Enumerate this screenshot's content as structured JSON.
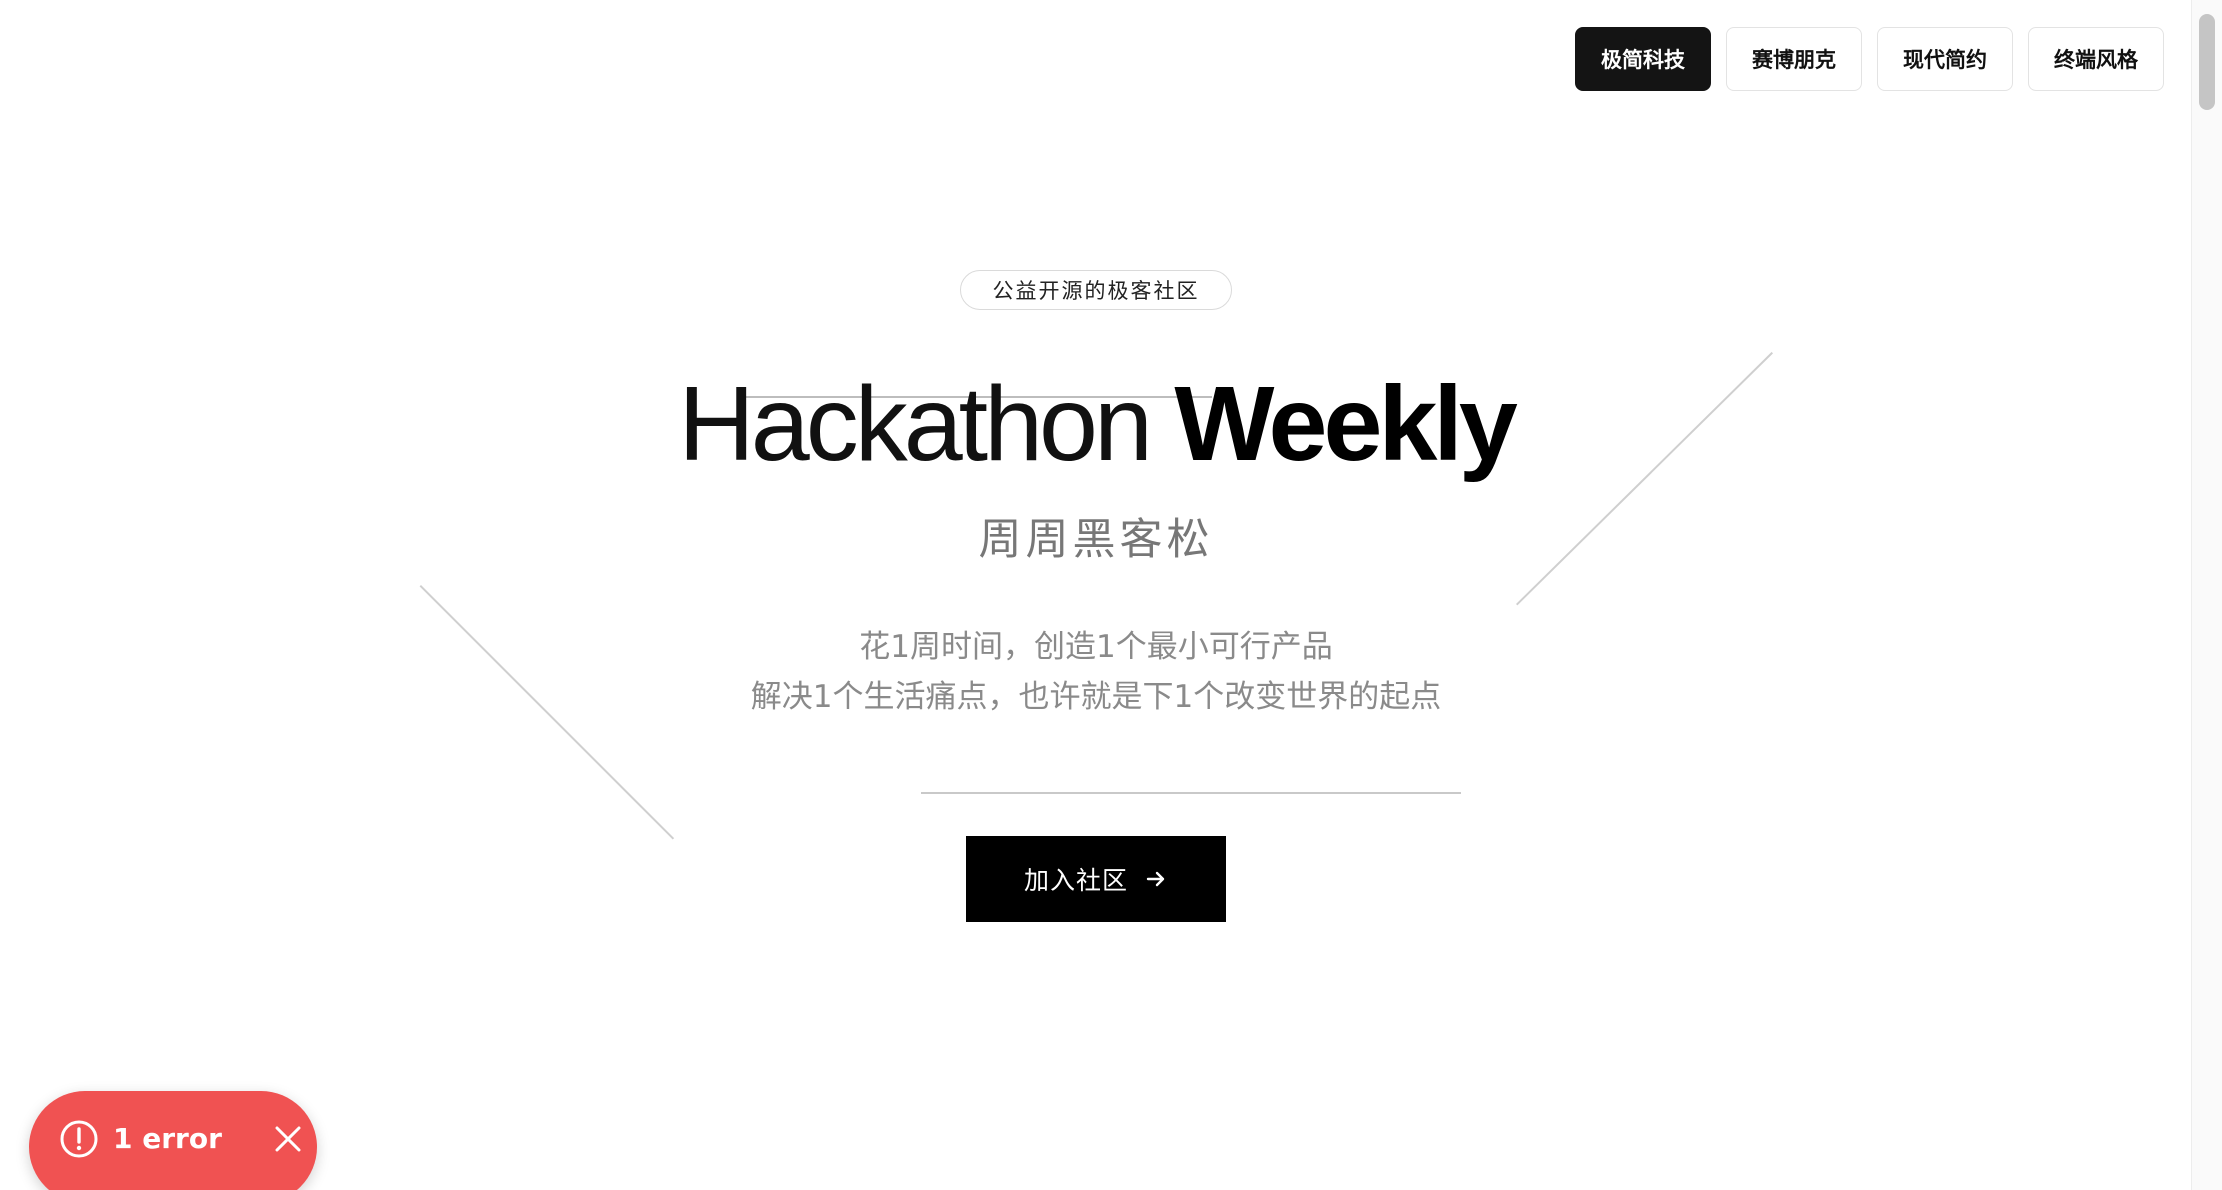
{
  "theme_switcher": {
    "options": [
      {
        "label": "极简科技",
        "active": true
      },
      {
        "label": "赛博朋克",
        "active": false
      },
      {
        "label": "现代简约",
        "active": false
      },
      {
        "label": "终端风格",
        "active": false
      }
    ]
  },
  "hero": {
    "badge": "公益开源的极客社区",
    "title_light": "Hackathon",
    "title_bold": "Weekly",
    "subtitle": "周周黑客松",
    "description_lines": [
      "花1周时间，创造1个最小可行产品",
      "解决1个生活痛点，也许就是下1个改变世界的起点"
    ],
    "cta_label": "加入社区",
    "cta_icon": "arrow-right-icon"
  },
  "error_toast": {
    "text": "1 error",
    "icon": "alert-circle-icon",
    "close_icon": "close-icon",
    "color": "#f05252"
  },
  "colors": {
    "background": "#ffffff",
    "primary": "#000000",
    "muted_text": "#8a8a8a",
    "active_theme_bg": "#141414"
  }
}
